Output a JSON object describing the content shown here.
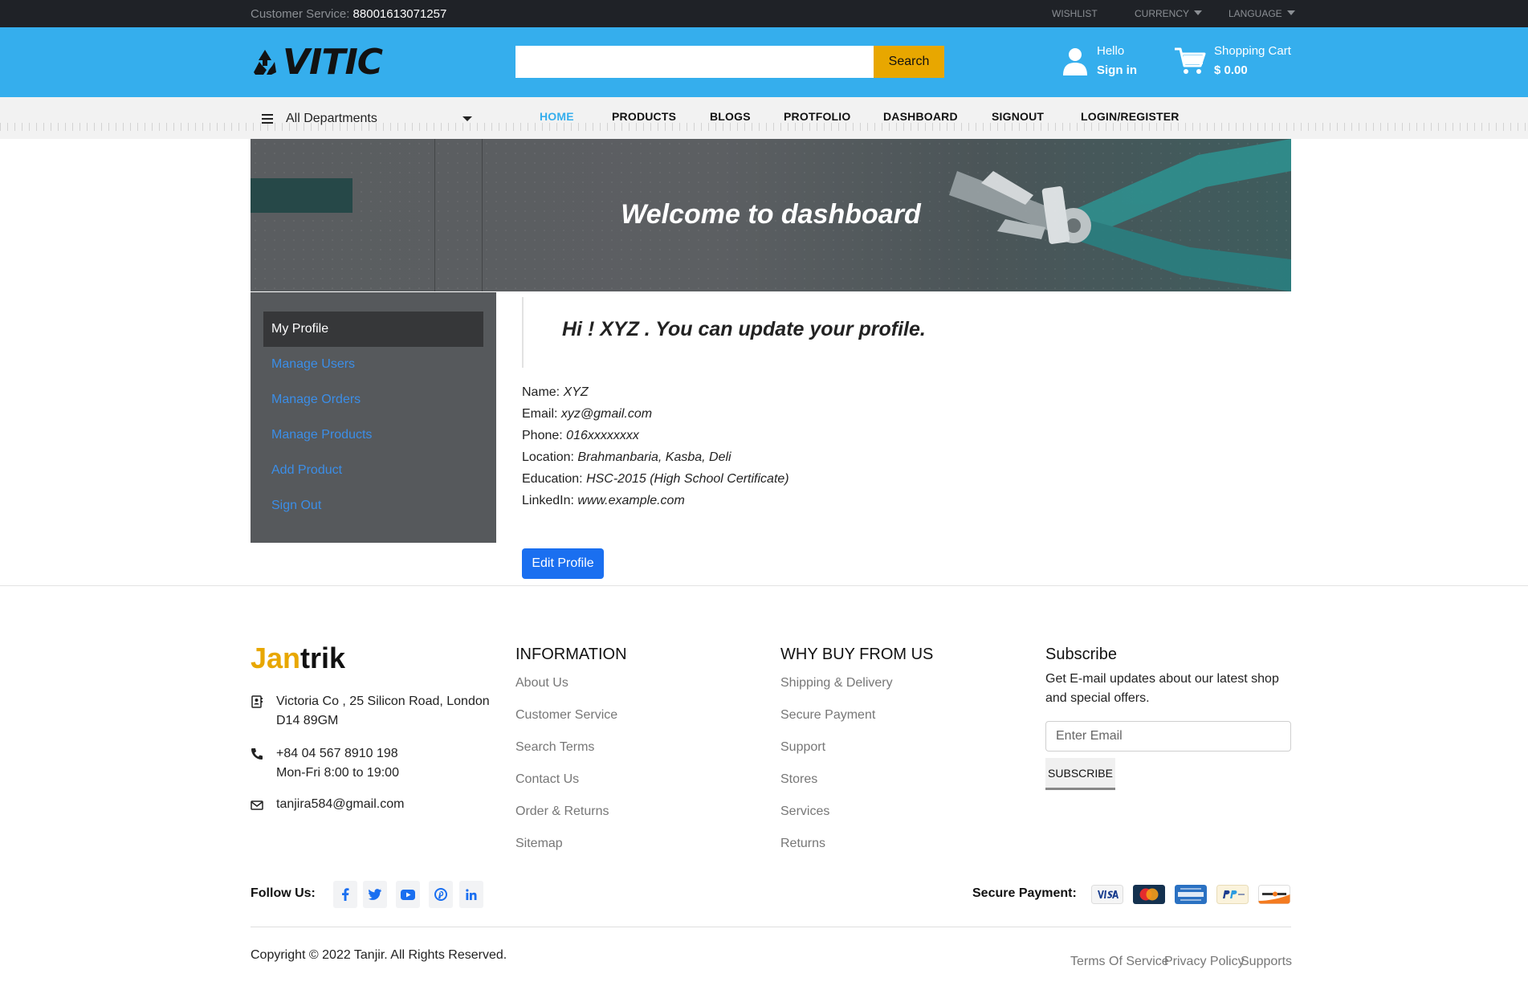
{
  "topbar": {
    "customer_service_label": "Customer Service:",
    "customer_service_phone": "88001613071257",
    "wishlist": "WISHLIST",
    "currency": "CURRENCY",
    "language": "LANGUAGE"
  },
  "header": {
    "logo_text": "VITIC",
    "search_placeholder": "",
    "search_button": "Search",
    "account_greeting": "Hello",
    "account_action": "Sign in",
    "cart_label": "Shopping Cart",
    "cart_total": "$ 0.00"
  },
  "nav": {
    "departments": "All Departments",
    "links": [
      "HOME",
      "PRODUCTS",
      "BLOGS",
      "PROTFOLIO",
      "DASHBOARD",
      "SIGNOUT",
      "LOGIN/REGISTER"
    ],
    "active": "HOME",
    "active_color": "#35aeed"
  },
  "banner": {
    "title": "Welcome to dashboard"
  },
  "sidebar": {
    "items": [
      "My Profile",
      "Manage Users",
      "Manage Orders",
      "Manage Products",
      "Add Product",
      "Sign Out"
    ],
    "active": "My Profile"
  },
  "profile": {
    "greeting": "Hi ! XYZ . You can update your profile.",
    "fields": [
      {
        "label": "Name:",
        "value": "XYZ"
      },
      {
        "label": "Email:",
        "value": "xyz@gmail.com"
      },
      {
        "label": "Phone:",
        "value": "016xxxxxxxx"
      },
      {
        "label": "Location:",
        "value": "Brahmanbaria, Kasba, Deli"
      },
      {
        "label": "Education:",
        "value": "HSC-2015 (High School Certificate)"
      },
      {
        "label": "LinkedIn:",
        "value": "www.example.com"
      }
    ],
    "edit_button": "Edit Profile",
    "button_color": "#1a6ff0"
  },
  "footer": {
    "logo_accent": "Jan",
    "logo_rest": "trik",
    "address_line1": "Victoria Co , 25 Silicon Road, London",
    "address_line2": "D14 89GM",
    "phone": "+84 04 567 8910 198",
    "hours": "Mon-Fri 8:00 to 19:00",
    "email": "tanjira584@gmail.com",
    "information": {
      "title": "INFORMATION",
      "links": [
        "About Us",
        "Customer Service",
        "Search Terms",
        "Contact Us",
        "Order & Returns",
        "Sitemap"
      ]
    },
    "why_buy": {
      "title": "WHY BUY FROM US",
      "links": [
        "Shipping & Delivery",
        "Secure Payment",
        "Support",
        "Stores",
        "Services",
        "Returns"
      ]
    },
    "subscribe": {
      "title": "Subscribe",
      "text": "Get E-mail updates about our latest shop and special offers.",
      "placeholder": "Enter Email",
      "button": "SUBSCRIBE"
    },
    "follow_label": "Follow Us:",
    "social_icons": [
      "facebook-icon",
      "twitter-icon",
      "youtube-icon",
      "pinterest-icon",
      "linkedin-icon"
    ],
    "secure_payment_label": "Secure Payment:",
    "payment_icons": [
      "visa-icon",
      "mastercard-icon",
      "amex-icon",
      "paypal-icon",
      "discover-icon"
    ],
    "copyright": "Copyright © 2022 Tanjir. All Rights Reserved.",
    "bottom_links": [
      "Terms Of Service",
      "Privacy Policy",
      "Supports"
    ]
  }
}
